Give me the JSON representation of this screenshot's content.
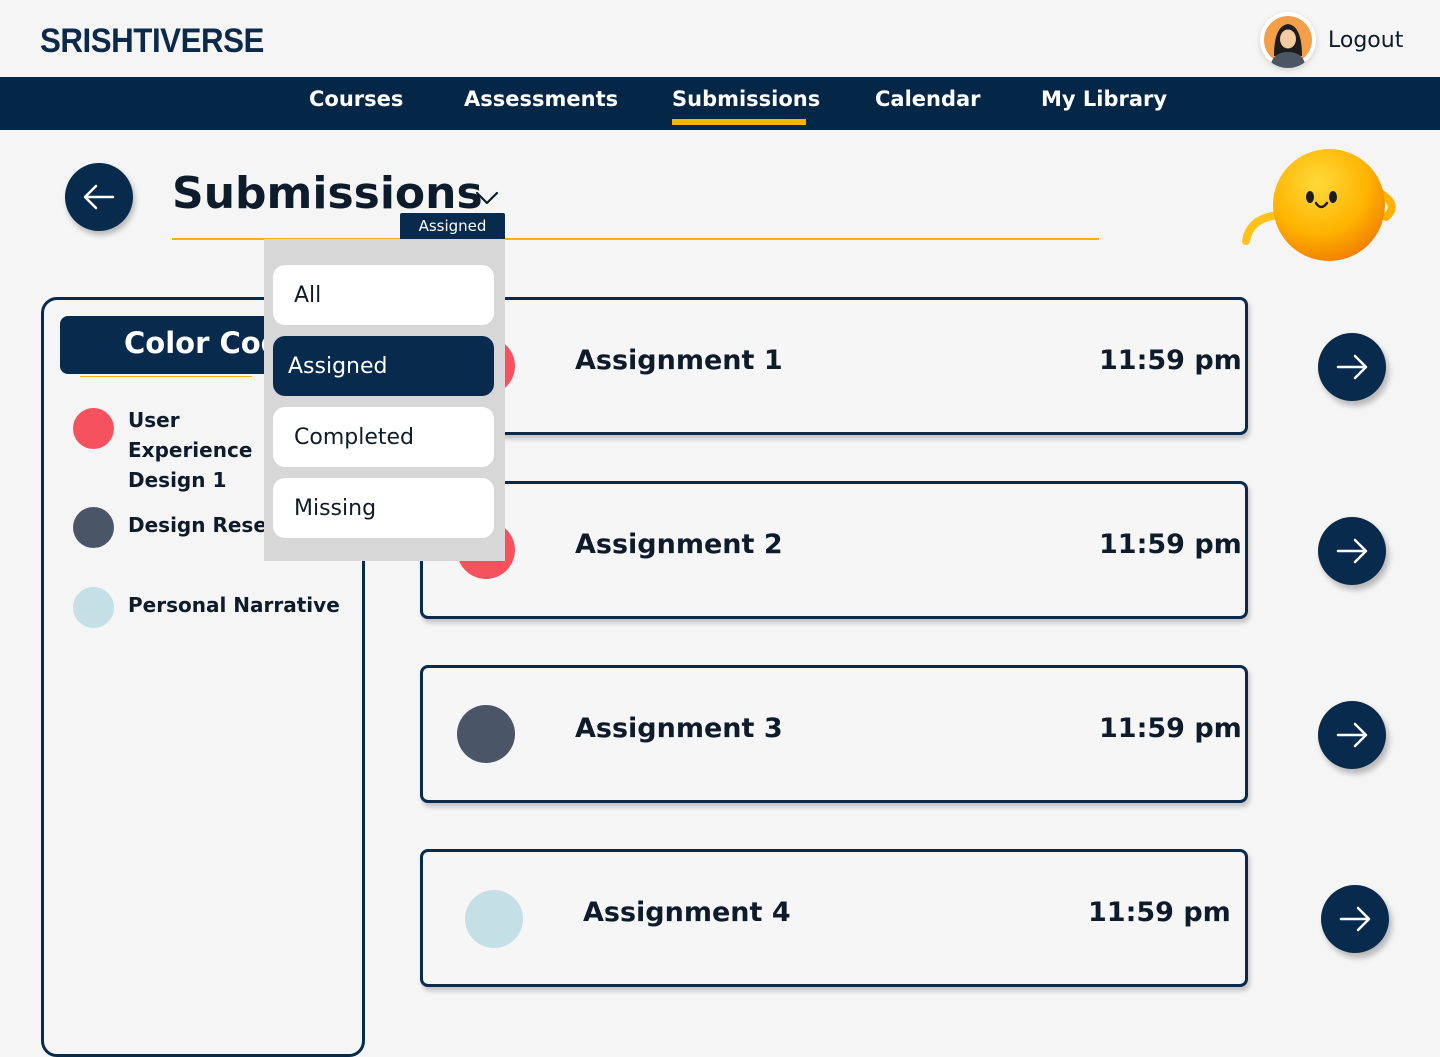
{
  "brand": "SRISHTIVERSE",
  "header": {
    "logout_label": "Logout"
  },
  "nav": {
    "items": [
      {
        "label": "Courses"
      },
      {
        "label": "Assessments"
      },
      {
        "label": "Submissions",
        "active": true
      },
      {
        "label": "Calendar"
      },
      {
        "label": "My Library"
      }
    ]
  },
  "page": {
    "title": "Submissions",
    "filter_selected": "Assigned",
    "filter_options": [
      "All",
      "Assigned",
      "Completed",
      "Missing"
    ]
  },
  "color_code": {
    "title": "Color Code",
    "items": [
      {
        "label": "User Experience Design 1",
        "color": "#f5515f"
      },
      {
        "label": "Design Research",
        "color": "#4a5568"
      },
      {
        "label": "Personal Narrative",
        "color": "#c4dfe6"
      }
    ]
  },
  "assignments": [
    {
      "name": "Assignment 1",
      "time": "11:59 pm",
      "color": "#f5515f"
    },
    {
      "name": "Assignment 2",
      "time": "11:59 pm",
      "color": "#f5515f"
    },
    {
      "name": "Assignment 3",
      "time": "11:59 pm",
      "color": "#4a5568"
    },
    {
      "name": "Assignment 4",
      "time": "11:59 pm",
      "color": "#c4dfe6"
    }
  ],
  "colors": {
    "primary": "#072a4d",
    "accent": "#f5b400",
    "background": "#f5f5f5"
  },
  "icons": [
    "user-avatar-icon",
    "arrow-left-icon",
    "chevron-down-icon",
    "arrow-right-icon",
    "mascot-icon"
  ]
}
